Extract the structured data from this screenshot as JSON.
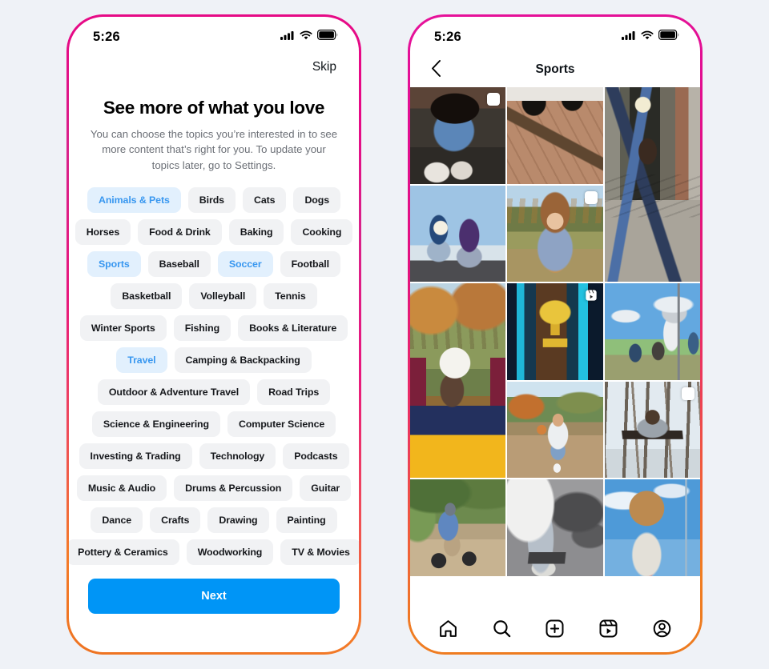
{
  "page": {
    "background_color": "#eff2f7"
  },
  "left_phone": {
    "frame_gradient": [
      "#e60a86",
      "#ef4a5c",
      "#ee7321"
    ],
    "status_bar": {
      "time": "5:26",
      "icons": [
        "cellular-signal-icon",
        "wifi-icon",
        "battery-icon"
      ]
    },
    "skip_label": "Skip",
    "headline": "See more of what you love",
    "subtext": "You can choose the topics you’re interested in to see more content that’s right for you. To update your topics later, go to Settings.",
    "selected_color": "#3897f0",
    "selected_bg": "#e2f0fd",
    "chip_bg": "#f1f2f4",
    "chip_rows": [
      [
        {
          "label": "Animals & Pets",
          "selected": true
        },
        {
          "label": "Birds",
          "selected": false
        },
        {
          "label": "Cats",
          "selected": false
        },
        {
          "label": "Dogs",
          "selected": false
        }
      ],
      [
        {
          "label": "Horses",
          "selected": false
        },
        {
          "label": "Food & Drink",
          "selected": false
        },
        {
          "label": "Baking",
          "selected": false
        },
        {
          "label": "Cooking",
          "selected": false
        }
      ],
      [
        {
          "label": "Sports",
          "selected": true
        },
        {
          "label": "Baseball",
          "selected": false
        },
        {
          "label": "Soccer",
          "selected": true
        },
        {
          "label": "Football",
          "selected": false
        }
      ],
      [
        {
          "label": "Basketball",
          "selected": false
        },
        {
          "label": "Volleyball",
          "selected": false
        },
        {
          "label": "Tennis",
          "selected": false
        }
      ],
      [
        {
          "label": "Winter Sports",
          "selected": false
        },
        {
          "label": "Fishing",
          "selected": false
        },
        {
          "label": "Books & Literature",
          "selected": false
        }
      ],
      [
        {
          "label": "Travel",
          "selected": true
        },
        {
          "label": "Camping & Backpacking",
          "selected": false
        }
      ],
      [
        {
          "label": "Outdoor & Adventure Travel",
          "selected": false
        },
        {
          "label": "Road Trips",
          "selected": false
        }
      ],
      [
        {
          "label": "Science & Engineering",
          "selected": false
        },
        {
          "label": "Computer Science",
          "selected": false
        }
      ],
      [
        {
          "label": "Investing & Trading",
          "selected": false
        },
        {
          "label": "Technology",
          "selected": false
        },
        {
          "label": "Podcasts",
          "selected": false
        }
      ],
      [
        {
          "label": "Music & Audio",
          "selected": false
        },
        {
          "label": "Drums & Percussion",
          "selected": false
        },
        {
          "label": "Guitar",
          "selected": false
        }
      ],
      [
        {
          "label": "Dance",
          "selected": false
        },
        {
          "label": "Crafts",
          "selected": false
        },
        {
          "label": "Drawing",
          "selected": false
        },
        {
          "label": "Painting",
          "selected": false
        }
      ],
      [
        {
          "label": "Pottery & Ceramics",
          "selected": false
        },
        {
          "label": "Woodworking",
          "selected": false
        },
        {
          "label": "TV & Movies",
          "selected": false
        }
      ]
    ],
    "next_label": "Next",
    "next_color": "#0095f6"
  },
  "right_phone": {
    "frame_gradient": [
      "#e6119a",
      "#ea2f64",
      "#ed7b1f"
    ],
    "status_bar": {
      "time": "5:26",
      "icons": [
        "cellular-signal-icon",
        "wifi-icon",
        "battery-icon"
      ]
    },
    "header": {
      "back_icon": "chevron-left-icon",
      "title": "Sports"
    },
    "grid_tiles": [
      {
        "id": "tile-1",
        "description": "Person in denim jacket sitting on bench tying shoes with dog",
        "badge": "carousel",
        "span": 1
      },
      {
        "id": "tile-2",
        "description": "Skateboard flipping mid-air on brick pavement",
        "badge": "none",
        "span": 1
      },
      {
        "id": "tile-3",
        "description": "Person leaping in split jump in a stairwell breezeway",
        "badge": "none",
        "span": 2
      },
      {
        "id": "tile-4",
        "description": "Two skateboarders against bright sky",
        "badge": "none",
        "span": 1
      },
      {
        "id": "tile-5",
        "description": "Girl in yellow shirt holding baseball glove in park",
        "badge": "carousel",
        "span": 1
      },
      {
        "id": "tile-6",
        "description": "Person balancing soccer ball on face in autumn park",
        "badge": "none",
        "span": 2
      },
      {
        "id": "tile-7",
        "description": "Gold soccer trophy against blue foil backdrop",
        "badge": "reel",
        "span": 1
      },
      {
        "id": "tile-8",
        "description": "Basketball players dunking on outdoor court",
        "badge": "none",
        "span": 1
      },
      {
        "id": "tile-9",
        "description": "Runner with prosthetic leg dribbling basketball",
        "badge": "none",
        "span": 1
      },
      {
        "id": "tile-10",
        "description": "Person leaping over log in bare winter forest",
        "badge": "carousel",
        "span": 1
      },
      {
        "id": "tile-11",
        "description": "Child riding BMX bike on park path",
        "badge": "none",
        "span": 1
      },
      {
        "id": "tile-12",
        "description": "Skateboarder legs and long shadow on asphalt",
        "badge": "none",
        "span": 1
      },
      {
        "id": "tile-13",
        "description": "Kid holding basketball in front of face against blue sky",
        "badge": "none",
        "span": 1
      }
    ],
    "nav_items": [
      {
        "name": "home-icon",
        "label": "Home"
      },
      {
        "name": "search-icon",
        "label": "Search"
      },
      {
        "name": "create-icon",
        "label": "Create"
      },
      {
        "name": "reels-icon",
        "label": "Reels"
      },
      {
        "name": "profile-icon",
        "label": "Profile"
      }
    ]
  }
}
